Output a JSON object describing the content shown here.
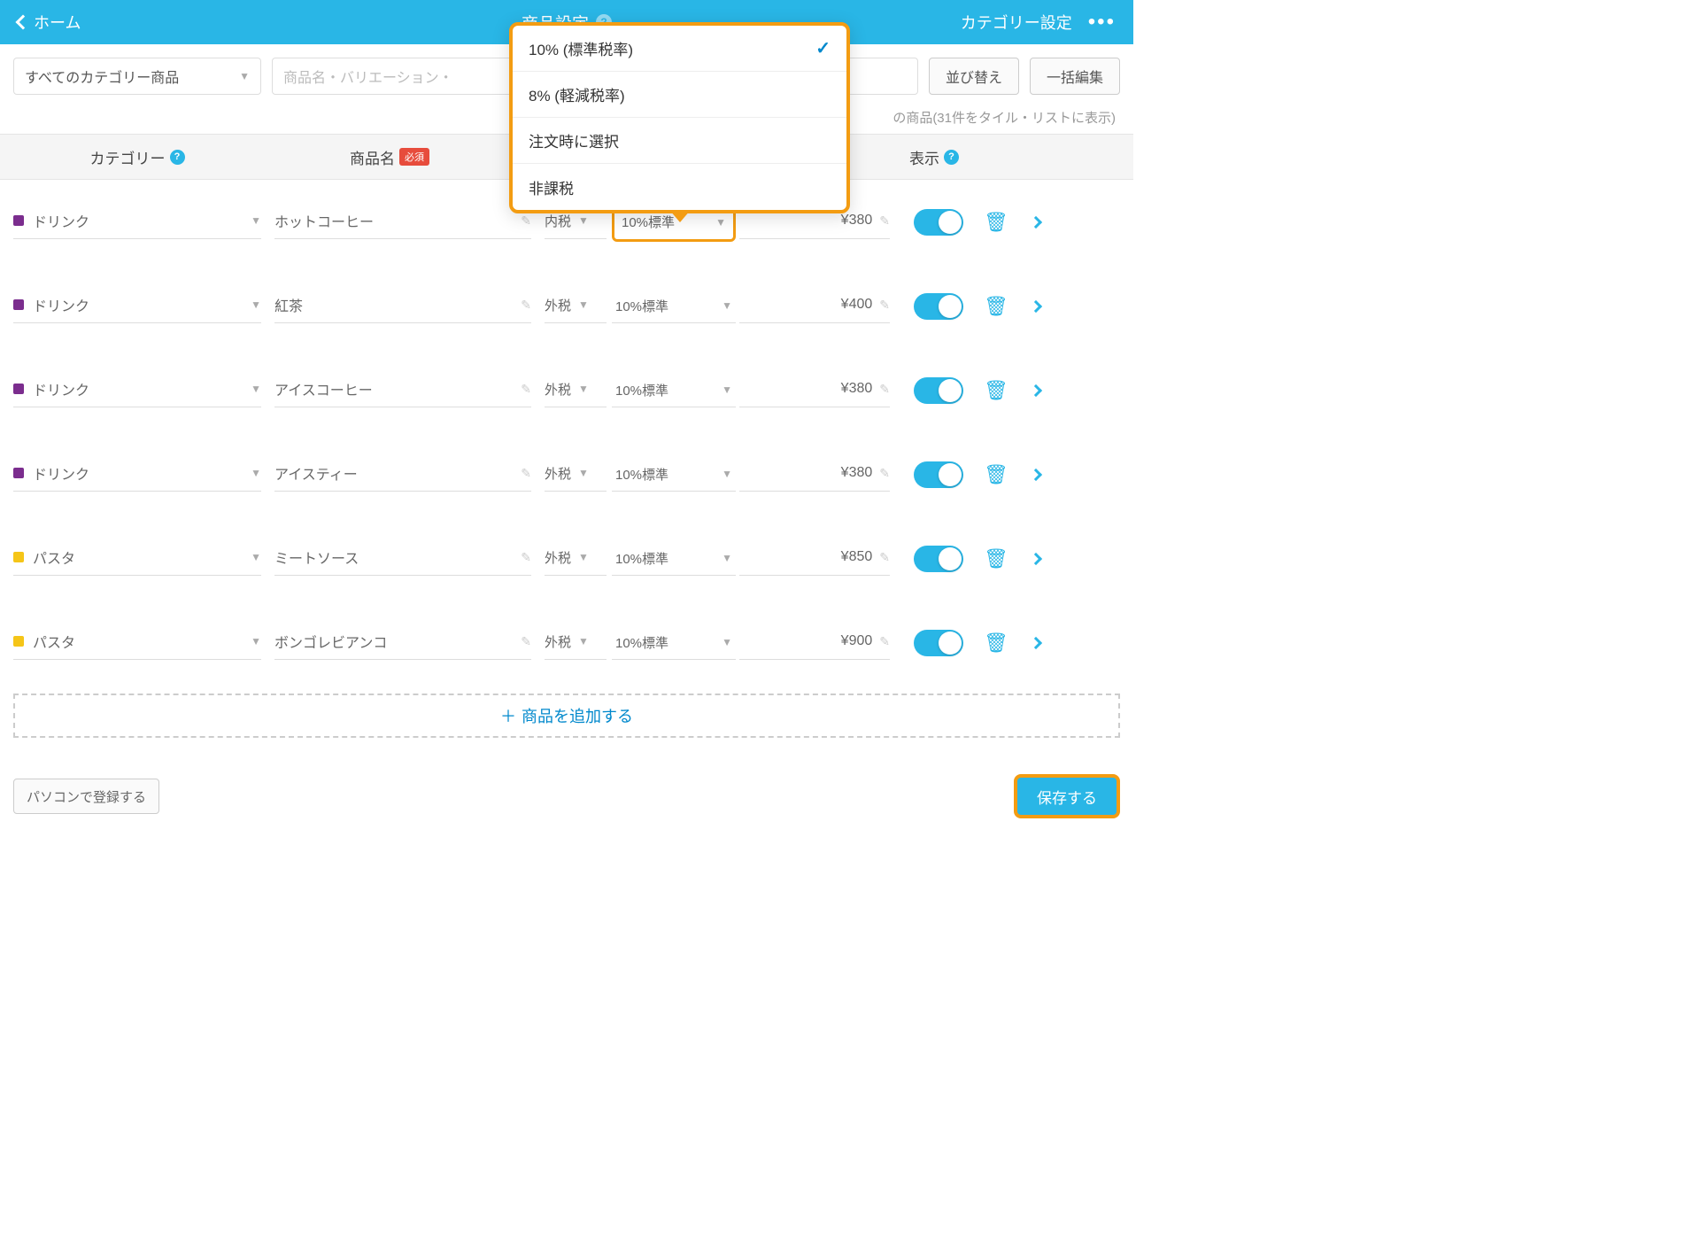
{
  "header": {
    "back": "ホーム",
    "title": "商品設定",
    "right": "カテゴリー設定"
  },
  "toolbar": {
    "category": "すべてのカテゴリー商品",
    "search_ph": "商品名・バリエーション・",
    "sort": "並び替え",
    "bulk": "一括編集"
  },
  "count": "の商品(31件をタイル・リストに表示)",
  "thead": {
    "cat": "カテゴリー",
    "name": "商品名",
    "req": "必須",
    "disp": "表示"
  },
  "popup": {
    "opts": [
      "10% (標準税率)",
      "8% (軽減税率)",
      "注文時に選択",
      "非課税"
    ]
  },
  "hl_tax": "10%標準",
  "rows": [
    {
      "color": "purple",
      "cat": "ドリンク",
      "name": "ホットコーヒー",
      "tax1": "内税",
      "tax2": "10%標準",
      "price": "¥380",
      "hl": true
    },
    {
      "color": "purple",
      "cat": "ドリンク",
      "name": "紅茶",
      "tax1": "外税",
      "tax2": "10%標準",
      "price": "¥400"
    },
    {
      "color": "purple",
      "cat": "ドリンク",
      "name": "アイスコーヒー",
      "tax1": "外税",
      "tax2": "10%標準",
      "price": "¥380"
    },
    {
      "color": "purple",
      "cat": "ドリンク",
      "name": "アイスティー",
      "tax1": "外税",
      "tax2": "10%標準",
      "price": "¥380"
    },
    {
      "color": "yellow",
      "cat": "パスタ",
      "name": "ミートソース",
      "tax1": "外税",
      "tax2": "10%標準",
      "price": "¥850"
    },
    {
      "color": "yellow",
      "cat": "パスタ",
      "name": "ボンゴレビアンコ",
      "tax1": "外税",
      "tax2": "10%標準",
      "price": "¥900"
    }
  ],
  "add": "商品を追加する",
  "footer": {
    "pc": "パソコンで登録する",
    "save": "保存する"
  }
}
